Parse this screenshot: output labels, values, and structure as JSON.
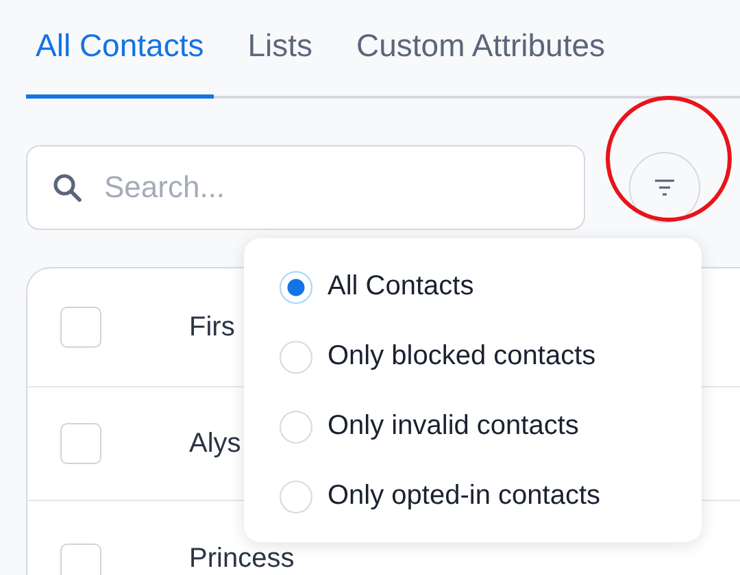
{
  "tabs": [
    {
      "label": "All Contacts",
      "selected": true
    },
    {
      "label": "Lists",
      "selected": false
    },
    {
      "label": "Custom Attributes",
      "selected": false
    }
  ],
  "search": {
    "placeholder": "Search..."
  },
  "table": {
    "header": {
      "checked": false,
      "column_1": "Firs"
    },
    "rows": [
      {
        "checked": false,
        "name": "Alys"
      },
      {
        "checked": false,
        "name": "Princess"
      }
    ]
  },
  "filter_menu": {
    "options": [
      {
        "label": "All Contacts",
        "selected": true
      },
      {
        "label": "Only blocked contacts",
        "selected": false
      },
      {
        "label": "Only invalid contacts",
        "selected": false
      },
      {
        "label": "Only opted-in contacts",
        "selected": false
      }
    ]
  }
}
